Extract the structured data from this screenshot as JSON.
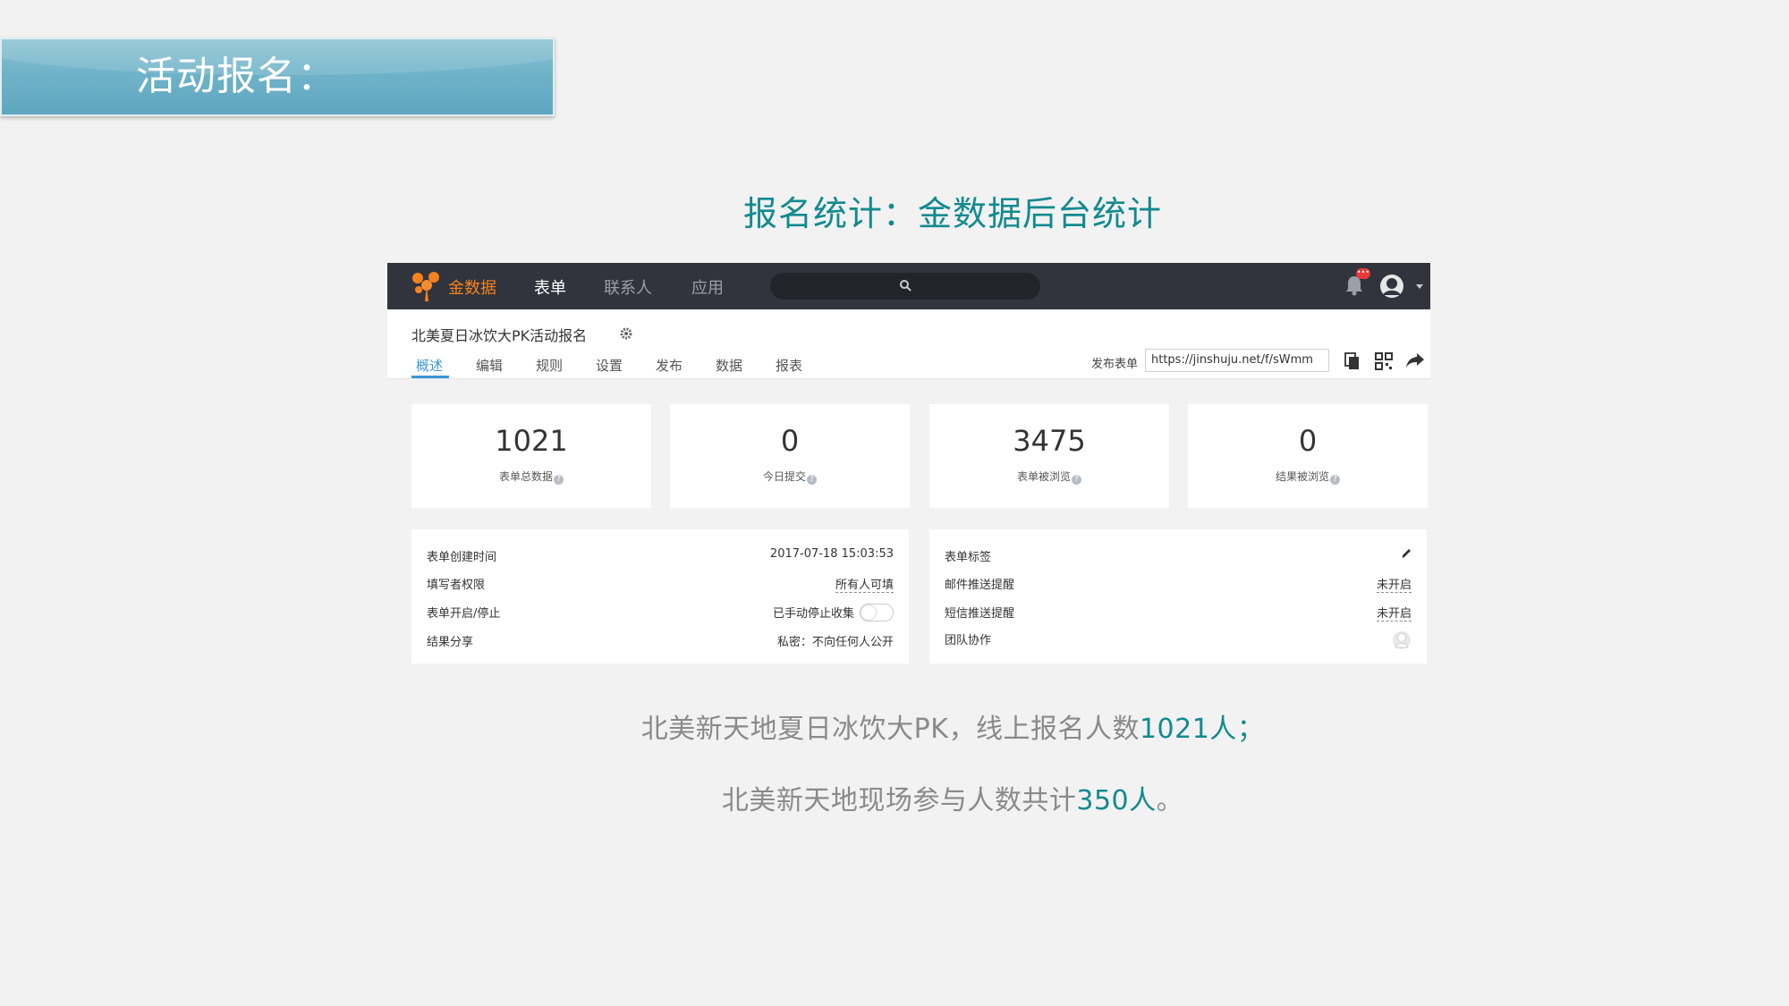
{
  "slide": {
    "heading": "活动报名：",
    "subtitle": "报名统计：金数据后台统计",
    "note1": {
      "prefix": "北美新天地夏日冰饮大PK，线上报名人数",
      "highlight": "1021人",
      "suffix": "；"
    },
    "note2": {
      "prefix": "北美新天地现场参与人数共计",
      "highlight": "350人",
      "suffix": "。"
    }
  },
  "app": {
    "brand": "金数据",
    "nav": [
      "表单",
      "联系人",
      "应用"
    ],
    "search_placeholder": "",
    "notification_badge": "•••",
    "form_title": "北美夏日冰饮大PK活动报名",
    "tabs": [
      "概述",
      "编辑",
      "规则",
      "设置",
      "发布",
      "数据",
      "报表"
    ],
    "active_tab": "概述",
    "publish_label": "发布表单",
    "publish_url": "https://jinshuju.net/f/sWmm",
    "stats": [
      {
        "value": "1021",
        "label": "表单总数据"
      },
      {
        "value": "0",
        "label": "今日提交"
      },
      {
        "value": "3475",
        "label": "表单被浏览"
      },
      {
        "value": "0",
        "label": "结果被浏览"
      }
    ],
    "left_panel": [
      {
        "key": "表单创建时间",
        "value": "2017-07-18 15:03:53"
      },
      {
        "key": "填写者权限",
        "value": "所有人可填"
      },
      {
        "key": "表单开启/停止",
        "value": "已手动停止收集"
      },
      {
        "key": "结果分享",
        "value": "私密：不向任何人公开"
      }
    ],
    "right_panel": [
      {
        "key": "表单标签",
        "value": ""
      },
      {
        "key": "邮件推送提醒",
        "value": "未开启"
      },
      {
        "key": "短信推送提醒",
        "value": "未开启"
      },
      {
        "key": "团队协作",
        "value": ""
      }
    ]
  },
  "colors": {
    "accent_teal": "#138a8f",
    "brand_orange": "#f5821f",
    "nav_bg": "#31343d",
    "tab_active": "#3a97d6"
  }
}
